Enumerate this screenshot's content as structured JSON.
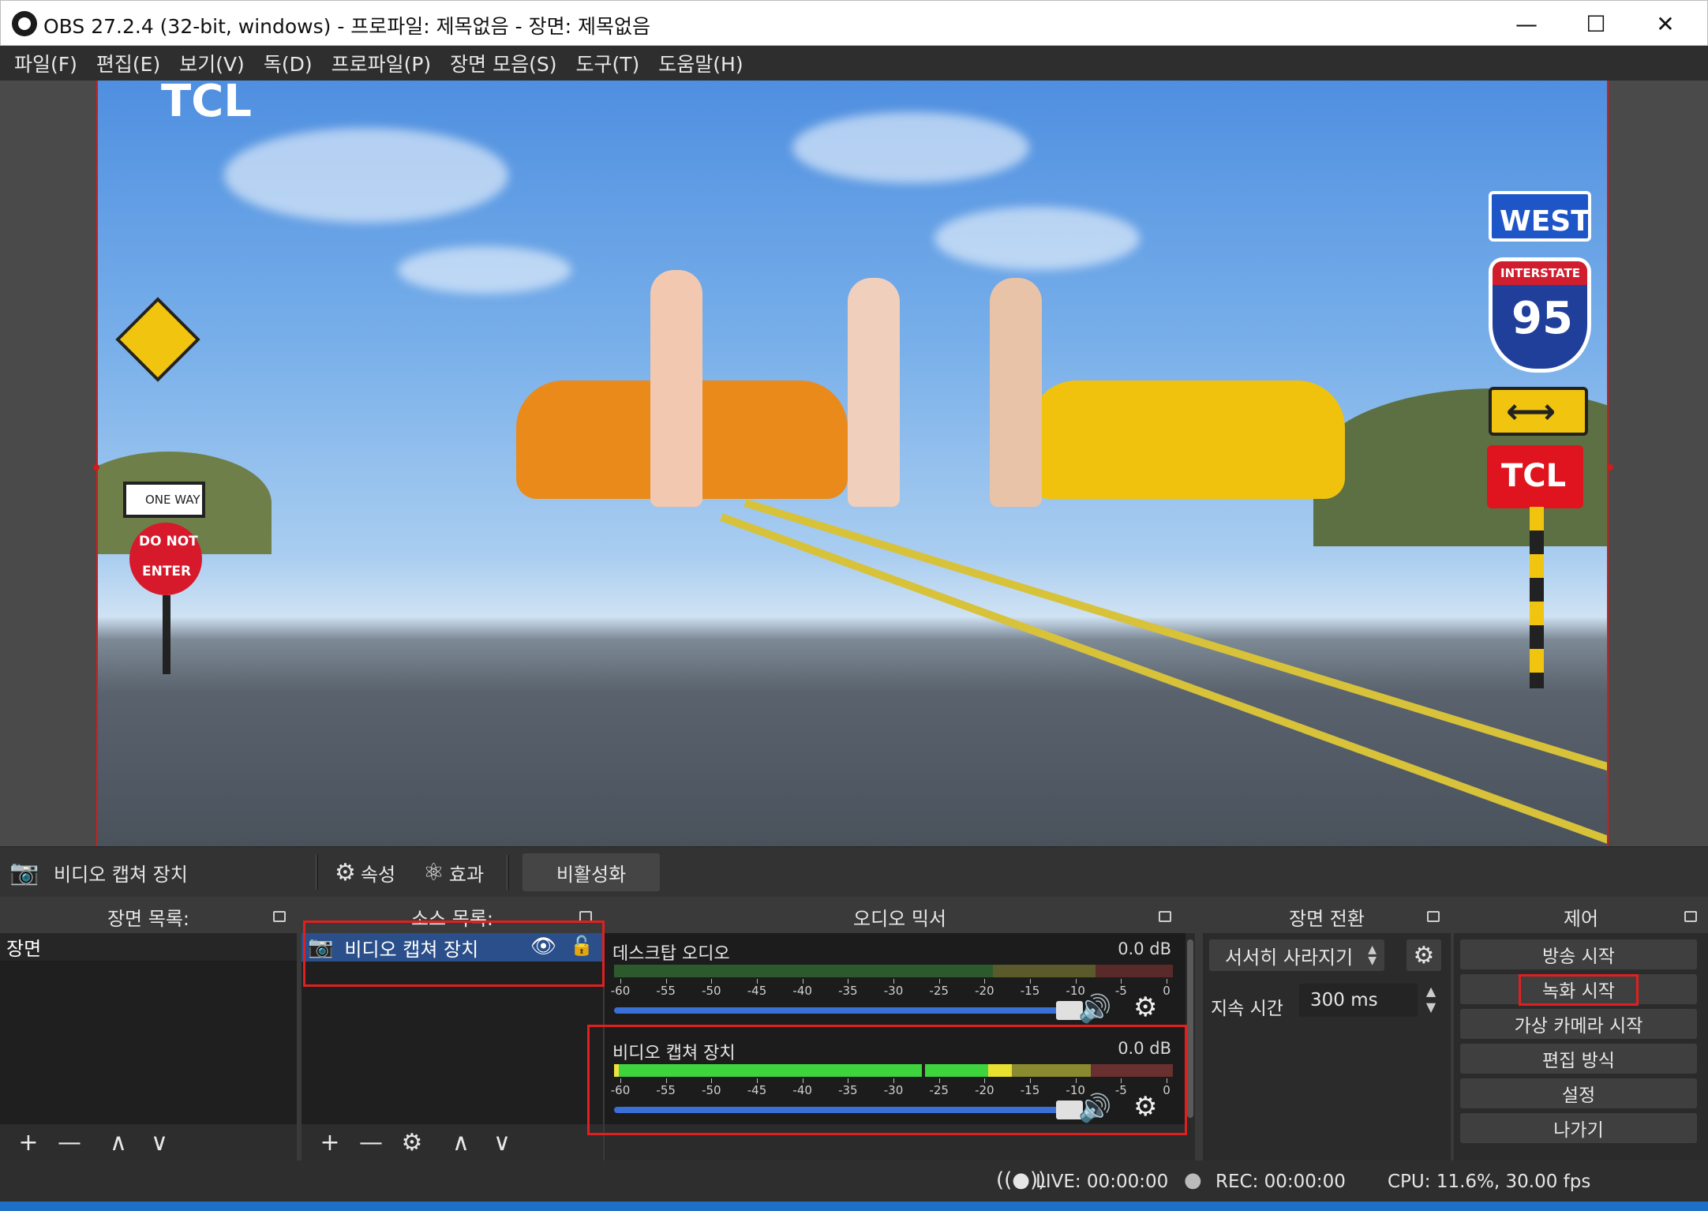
{
  "window": {
    "title": "OBS 27.2.4 (32-bit, windows) - 프로파일: 제목없음 - 장면: 제목없음",
    "minimize": "—",
    "maximize": "☐",
    "close": "✕"
  },
  "menu": [
    "파일(F)",
    "편집(E)",
    "보기(V)",
    "독(D)",
    "프로파일(P)",
    "장면 모음(S)",
    "도구(T)",
    "도움말(H)"
  ],
  "preview": {
    "signs": {
      "west": "WEST",
      "interstate": "INTERSTATE",
      "interstate_number": "95",
      "tcl": "TCL",
      "one_way": "ONE WAY",
      "do_not": "DO NOT",
      "enter": "ENTER",
      "tcl_top": "TCL"
    }
  },
  "source_toolbar": {
    "selected_source": "비디오 캡쳐 장치",
    "properties": "속성",
    "filters": "효과",
    "deactivate": "비활성화"
  },
  "scenes": {
    "header": "장면 목록:",
    "items": [
      "장면"
    ]
  },
  "sources": {
    "header": "소스 목록:",
    "items": [
      "비디오 캡쳐 장치"
    ]
  },
  "mixer": {
    "header": "오디오 믹서",
    "ticks": [
      "-60",
      "-55",
      "-50",
      "-45",
      "-40",
      "-35",
      "-30",
      "-25",
      "-20",
      "-15",
      "-10",
      "-5",
      "0"
    ],
    "channels": [
      {
        "name": "데스크탑 오디오",
        "db": "0.0 dB"
      },
      {
        "name": "비디오 캡쳐 장치",
        "db": "0.0 dB"
      }
    ]
  },
  "transition": {
    "header": "장면 전환",
    "selected": "서서히 사라지기",
    "duration_label": "지속 시간",
    "duration_value": "300 ms"
  },
  "controls": {
    "header": "제어",
    "buttons": [
      "방송 시작",
      "녹화 시작",
      "가상 카메라 시작",
      "편집 방식",
      "설정",
      "나가기"
    ]
  },
  "status": {
    "live": "LIVE: 00:00:00",
    "rec": "REC: 00:00:00",
    "cpu": "CPU: 11.6%, 30.00 fps"
  },
  "colors": {
    "accent_blue": "#3a6fd6",
    "highlight_red": "#e02020",
    "selection": "#2a4f8a"
  },
  "icons": {
    "add": "+",
    "remove": "—",
    "up": "∧",
    "down": "∨",
    "gear": "⚙",
    "speaker": "🔊",
    "eye": "👁",
    "lock": "🔓",
    "camera": "📷"
  }
}
